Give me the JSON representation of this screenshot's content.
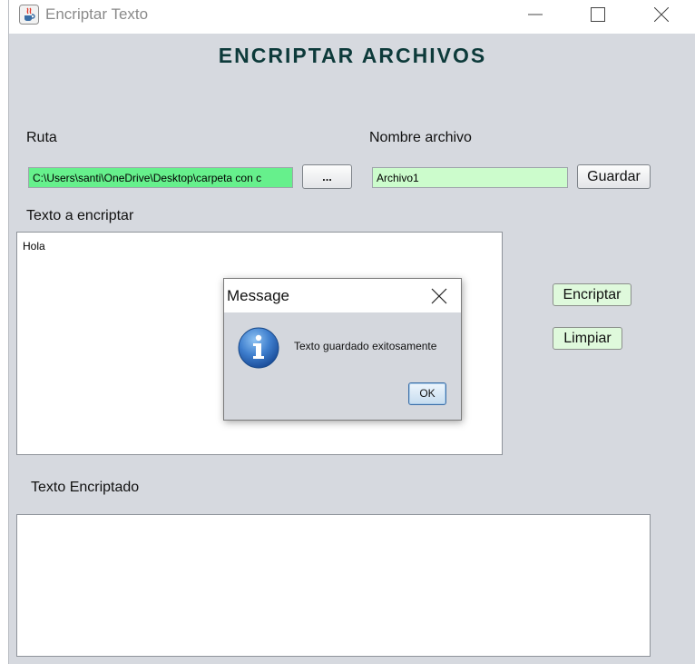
{
  "window": {
    "title": "Encriptar Texto",
    "controls": {
      "minimize": "minimize-icon",
      "maximize": "maximize-icon",
      "close": "close-icon"
    }
  },
  "form": {
    "heading": "ENCRIPTAR ARCHIVOS",
    "ruta_label": "Ruta",
    "ruta_value": "C:\\Users\\santi\\OneDrive\\Desktop\\carpeta con c",
    "browse_label": "...",
    "nombre_label": "Nombre archivo",
    "nombre_value": "Archivo1",
    "guardar_label": "Guardar",
    "texto_label": "Texto a encriptar",
    "texto_value": "Hola",
    "encriptar_label": "Encriptar",
    "limpiar_label": "Limpiar",
    "encriptado_label": "Texto Encriptado",
    "encriptado_value": ""
  },
  "dialog": {
    "title": "Message",
    "message": "Texto guardado exitosamente",
    "ok_label": "OK",
    "icon": "info-icon"
  },
  "colors": {
    "window_bg": "#d6d9df",
    "heading": "#0d3a3a",
    "ruta_field_bg": "#66f08c",
    "nombre_field_bg": "#ccfccc",
    "action_button_bg": "#dff9dc"
  }
}
